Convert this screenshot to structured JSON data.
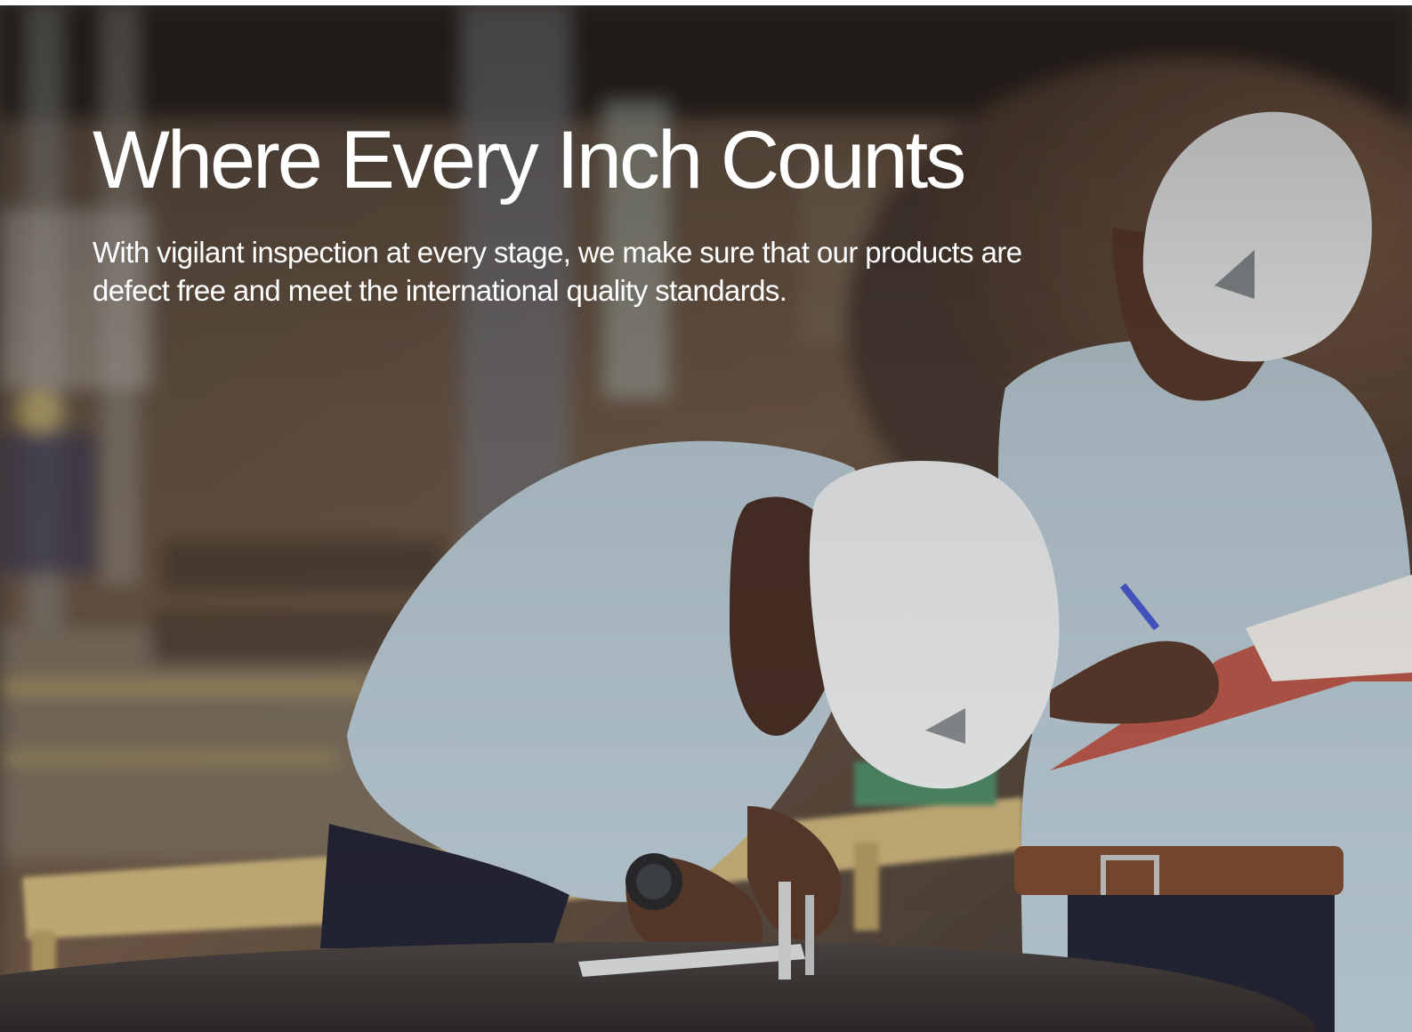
{
  "hero": {
    "headline": "Where Every Inch Counts",
    "subtext": "With vigilant inspection at every stage, we make sure that our products are defect free and meet the international quality standards."
  },
  "photo": {
    "subject": "two workers in white hard hats and light blue shirts inspecting a metal part with a caliper and taking notes in a factory",
    "colors": {
      "shirt": "#b9cad3",
      "helmet": "#eceeef",
      "background_warm": "#6e5846",
      "table_yellow": "#c9b27a",
      "metal_surface": "#3b3634"
    }
  }
}
